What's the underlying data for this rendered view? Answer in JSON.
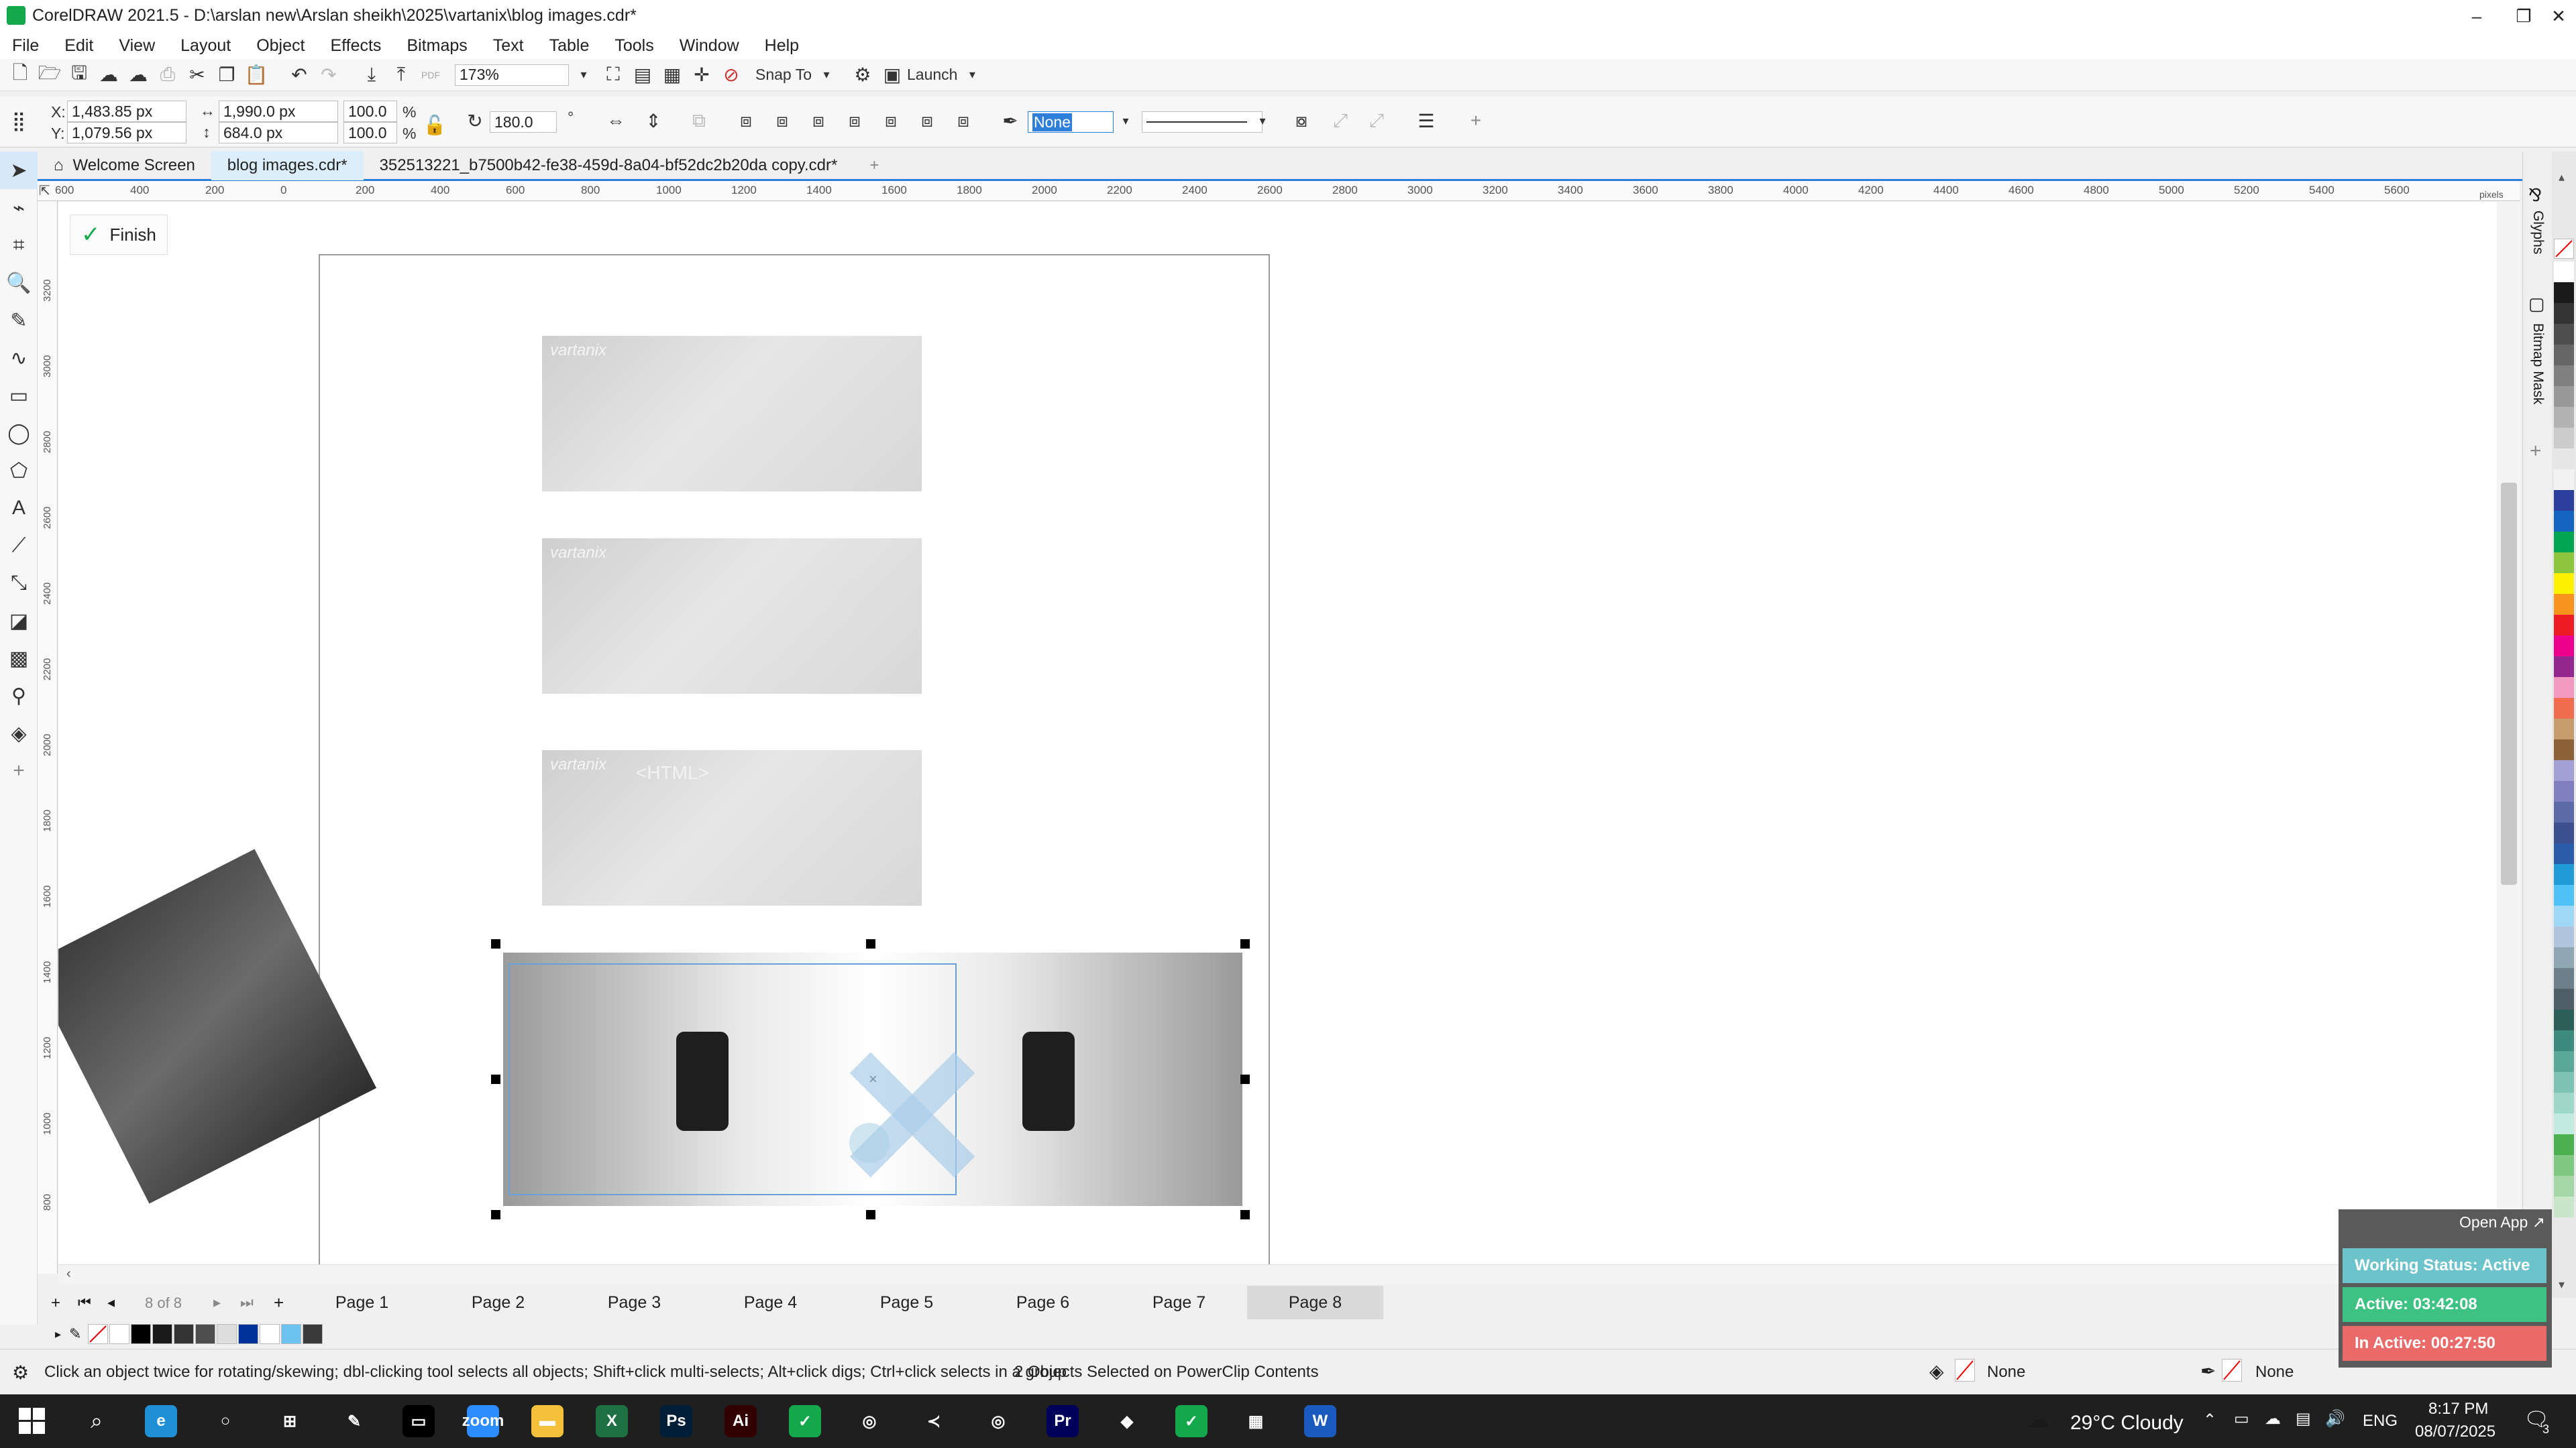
{
  "window": {
    "title": "CorelDRAW 2021.5 - D:\\arslan new\\Arslan sheikh\\2025\\vartanix\\blog images.cdr*",
    "controls": [
      "–",
      "❐",
      "✕"
    ]
  },
  "menu": [
    "File",
    "Edit",
    "View",
    "Layout",
    "Object",
    "Effects",
    "Bitmaps",
    "Text",
    "Table",
    "Tools",
    "Window",
    "Help"
  ],
  "toolbar": {
    "zoom": "173%",
    "snap_label": "Snap To",
    "launch_label": "Launch",
    "pdf_label": "PDF"
  },
  "properties": {
    "x_label": "X:",
    "x_value": "1,483.85 px",
    "y_label": "Y:",
    "y_value": "1,079.56 px",
    "width_value": "1,990.0 px",
    "height_value": "684.0 px",
    "scale_w": "100.0",
    "scale_h": "100.0",
    "percent": "%",
    "rotation": "180.0",
    "rotation_unit": "°",
    "outline_value": "None"
  },
  "tabs": {
    "welcome": "Welcome Screen",
    "doc1": "blog images.cdr*",
    "doc2": "352513221_b7500b42-fe38-459d-8a04-bf52dc2b20da copy.cdr*",
    "add": "+"
  },
  "ruler": {
    "top": [
      "600",
      "400",
      "200",
      "0",
      "200",
      "400",
      "600",
      "800",
      "1000",
      "1200",
      "1400",
      "1600",
      "1800",
      "2000",
      "2200",
      "2400",
      "2600",
      "2800",
      "3000",
      "3200",
      "3400",
      "3600",
      "3800",
      "4000",
      "4200",
      "4400",
      "4600",
      "4800",
      "5000",
      "5200",
      "5400",
      "5600"
    ],
    "top_unit": "pixels",
    "left": [
      "3200",
      "3000",
      "2800",
      "2600",
      "2400",
      "2200",
      "2000",
      "1800",
      "1600",
      "1400",
      "1200",
      "1000",
      "800"
    ],
    "left_unit": "pixels"
  },
  "finish_label": "Finish",
  "canvas": {
    "brand": "vartanix",
    "thumb3_overlay": "<HTML>"
  },
  "dockers": {
    "glyphs": "Glyphs",
    "bitmap_mask": "Bitmap Mask"
  },
  "pages": {
    "counter": "8 of 8",
    "tabs": [
      "Page 1",
      "Page 2",
      "Page 3",
      "Page 4",
      "Page 5",
      "Page 6",
      "Page 7",
      "Page 8"
    ],
    "active": "Page 8"
  },
  "status": {
    "hint": "Click an object twice for rotating/skewing; dbl-clicking tool selects all objects; Shift+click multi-selects; Alt+click digs; Ctrl+click selects in a group",
    "selection": "2 Objects Selected on PowerClip Contents",
    "fill": "None",
    "outline": "None"
  },
  "tracker": {
    "open_app": "Open App ↗",
    "working_status": "Working Status: Active",
    "active": "Active: 03:42:08",
    "inactive": "In Active: 00:27:50",
    "colors": {
      "status": "#6cc3cc",
      "active": "#3ec283",
      "inactive": "#ea6a6a"
    }
  },
  "taskbar": {
    "apps": [
      {
        "name": "edge",
        "glyph": "e",
        "color": "#1f8fd6"
      },
      {
        "name": "cortana",
        "glyph": "○",
        "color": "#1f1f1f"
      },
      {
        "name": "taskview",
        "glyph": "⊞",
        "color": "#1f1f1f"
      },
      {
        "name": "pen-tool",
        "glyph": "✎",
        "color": "#1f1f1f"
      },
      {
        "name": "terminal",
        "glyph": "▭",
        "color": "#000000"
      },
      {
        "name": "zoom",
        "glyph": "zoom",
        "color": "#2d8cff"
      },
      {
        "name": "explorer",
        "glyph": "▬",
        "color": "#f3c13a"
      },
      {
        "name": "excel",
        "glyph": "X",
        "color": "#1d7044"
      },
      {
        "name": "photoshop",
        "glyph": "Ps",
        "color": "#001e36"
      },
      {
        "name": "illustrator",
        "glyph": "Ai",
        "color": "#330000"
      },
      {
        "name": "coreldraw",
        "glyph": "✓",
        "color": "#13a84b"
      },
      {
        "name": "chrome",
        "glyph": "◎",
        "color": "#1f1f1f"
      },
      {
        "name": "vscode",
        "glyph": "≺",
        "color": "#1f1f1f"
      },
      {
        "name": "chrome-2",
        "glyph": "◎",
        "color": "#1f1f1f"
      },
      {
        "name": "premiere",
        "glyph": "Pr",
        "color": "#00005b"
      },
      {
        "name": "app-blue",
        "glyph": "◆",
        "color": "#1f1f1f"
      },
      {
        "name": "coreldraw-2",
        "glyph": "✓",
        "color": "#13a84b"
      },
      {
        "name": "calculator",
        "glyph": "▦",
        "color": "#1f1f1f"
      },
      {
        "name": "word",
        "glyph": "W",
        "color": "#185abd"
      }
    ],
    "weather": "29°C  Cloudy",
    "lang": "ENG",
    "time": "8:17 PM",
    "date": "08/07/2025",
    "notifications": "3"
  },
  "palette_colors": [
    "#ffffff",
    "#1a1a1a",
    "#333333",
    "#4d4d4d",
    "#666666",
    "#808080",
    "#999999",
    "#b3b3b3",
    "#cccccc",
    "#e6e6e6",
    "#f2f2f2",
    "#2c3e9e",
    "#1565c0",
    "#00a651",
    "#8dc63f",
    "#fff200",
    "#f7941d",
    "#ed1c24",
    "#ec008c",
    "#92278f",
    "#f49ac1",
    "#f26c4f",
    "#c69c6d",
    "#8c6239",
    "#a3a0d6",
    "#7f7fbf",
    "#5b6aa8",
    "#3c4f8f",
    "#2a5caa",
    "#1f9bd7",
    "#4fc3f7",
    "#9ed8f5",
    "#b0c4de",
    "#8fa7b3",
    "#6d7f8b",
    "#4e5d66",
    "#2c5f5a",
    "#3d8b7f",
    "#5aa89a",
    "#7cc3b3",
    "#9fd8c8",
    "#c2eadf",
    "#4caf50",
    "#81c784",
    "#a5d6a7",
    "#c8e6c9"
  ],
  "doc_palette": [
    "#ffffff",
    "#000000",
    "#1a1a1a",
    "#333333",
    "#4d4d4d",
    "#dddddd",
    "#003399",
    "#ffffff",
    "#6cc3f0",
    "#3a3a3a"
  ]
}
